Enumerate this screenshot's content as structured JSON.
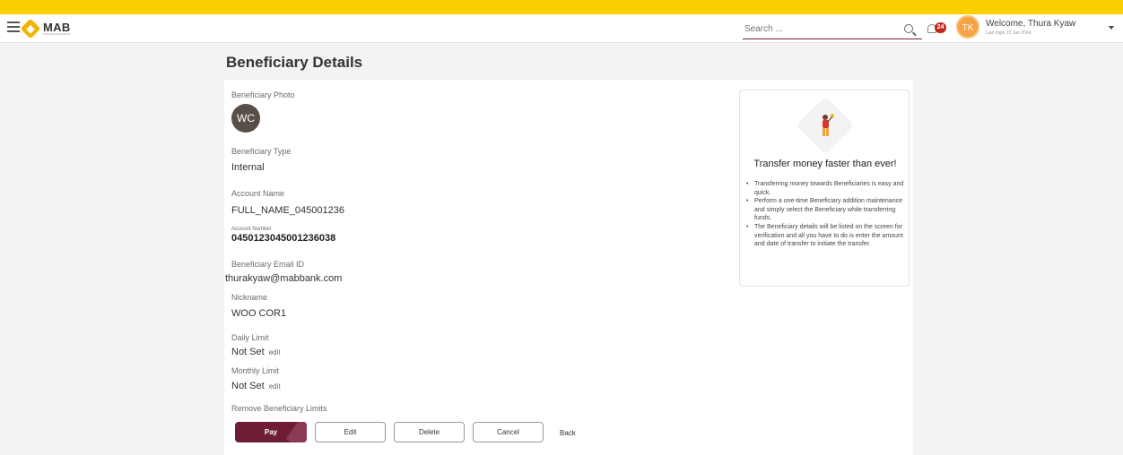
{
  "header": {
    "logo_text": "MAB",
    "logo_sub": "MYANMA APEX BANK",
    "search_placeholder": "Search ...",
    "notification_count": "24",
    "avatar_initials": "TK",
    "welcome": "Welcome, Thura Kyaw",
    "last_login": "Last login 23 Jan 2024,"
  },
  "page": {
    "title": "Beneficiary Details"
  },
  "details": {
    "photo_label": "Beneficiary Photo",
    "photo_initials": "WC",
    "type_label": "Beneficiary Type",
    "type_value": "Internal",
    "account_name_label": "Account Name",
    "account_name_value": "FULL_NAME_045001236",
    "account_number_label": "Account Number",
    "account_number_value": "0450123045001236038",
    "email_label": "Beneficiary Email ID",
    "email_value": "thurakyaw@mabbank.com",
    "nickname_label": "Nickname",
    "nickname_value": "WOO COR1",
    "daily_limit_label": "Daily Limit",
    "daily_limit_value": "Not Set",
    "monthly_limit_label": "Monthly Limit",
    "monthly_limit_value": "Not Set",
    "edit_link": "edit",
    "remove_limits_label": "Remove Beneficiary Limits"
  },
  "actions": {
    "pay": "Pay",
    "edit": "Edit",
    "delete": "Delete",
    "cancel": "Cancel",
    "back": "Back"
  },
  "info_panel": {
    "title": "Transfer money faster than ever!",
    "points": [
      "Transferring money towards Beneficiaries is easy and quick.",
      "Perform a one-time Beneficiary addition maintenance and simply select the Beneficiary while transferring funds.",
      "The Beneficiary details will be listed on the screen for verification and all you have to do is enter the amount and date of transfer to initiate the transfer."
    ]
  },
  "colors": {
    "top_bar": "#fbd000",
    "primary": "#6e1d34",
    "badge": "#c0281f",
    "avatar": "#f5a345"
  },
  "icons": [
    "menu-icon",
    "search-icon",
    "bell-icon",
    "chevron-down-icon"
  ]
}
